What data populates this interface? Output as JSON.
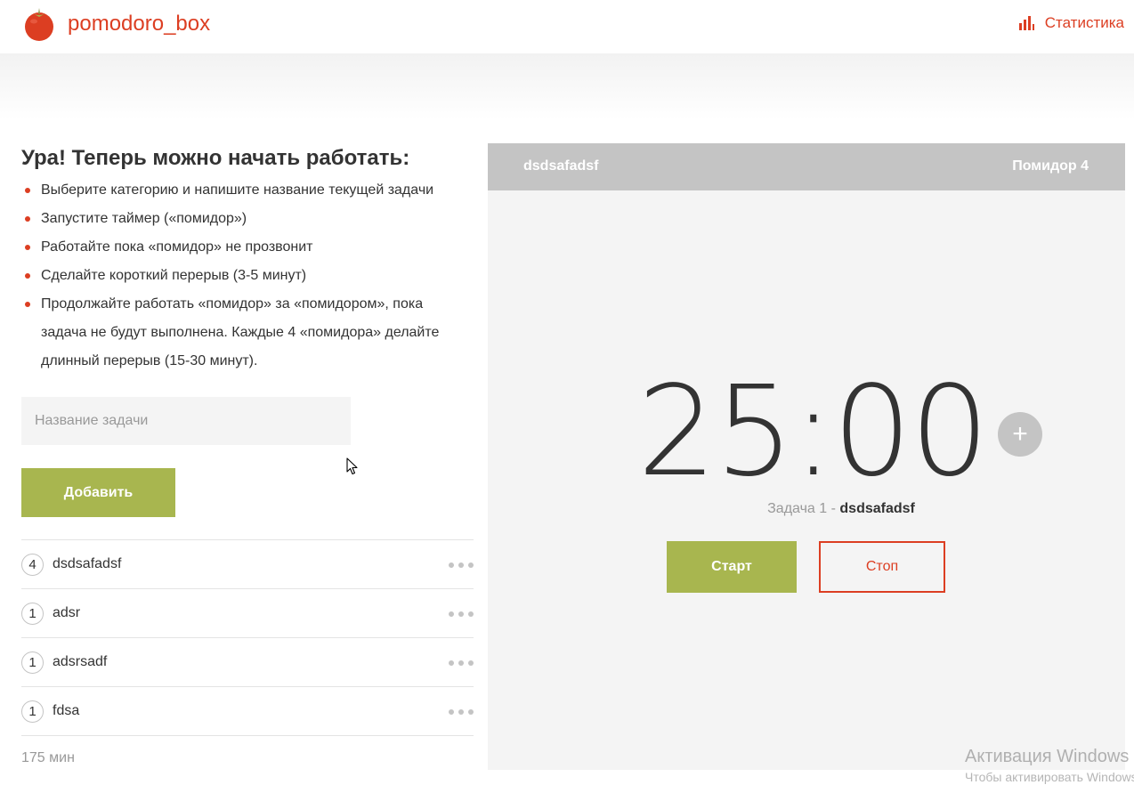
{
  "header": {
    "brand": "pomodoro_box",
    "logo_icon": "tomato-icon",
    "stats_link": "Статистика",
    "stats_icon": "bar-chart-icon"
  },
  "intro": {
    "title": "Ура! Теперь можно начать работать:",
    "steps": [
      "Выберите категорию и напишите название текущей задачи",
      "Запустите таймер («помидор»)",
      "Работайте пока «помидор» не прозвонит",
      "Сделайте короткий перерыв (3-5 минут)",
      "Продолжайте работать «помидор» за «помидором», пока задача не будут выполнена. Каждые 4 «помидора» делайте длинный перерыв (15-30 минут)."
    ]
  },
  "form": {
    "task_placeholder": "Название задачи",
    "task_value": "",
    "add_button": "Добавить"
  },
  "tasks": [
    {
      "count": "4",
      "name": "dsdsafadsf"
    },
    {
      "count": "1",
      "name": "adsr"
    },
    {
      "count": "1",
      "name": "adsrsadf"
    },
    {
      "count": "1",
      "name": "fdsa"
    }
  ],
  "total_time": "175 мин",
  "timer": {
    "task_name": "dsdsafadsf",
    "pomodoro_label": "Помидор 4",
    "time": "25:00",
    "minutes": "25",
    "seconds": "00",
    "caption_label": "Задача 1 - ",
    "caption_task": "dsdsafadsf",
    "add_time_button": "+",
    "start_button": "Старт",
    "stop_button": "Стоп"
  },
  "watermark": {
    "title": "Активация Windows",
    "subtitle": "Чтобы активировать Windows"
  },
  "colors": {
    "accent_red": "#DC3E22",
    "accent_green": "#A8B64F",
    "panel_bg": "#F4F4F4",
    "panel_header": "#C4C4C4",
    "text": "#333333",
    "muted": "#999999"
  }
}
